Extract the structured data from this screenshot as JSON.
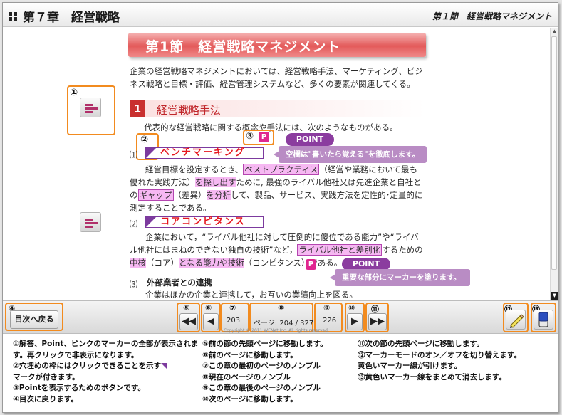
{
  "header": {
    "chapter_title": "第７章　経営戦略",
    "section_ref": "第１節　経営戦略マネジメント"
  },
  "content": {
    "section_banner": "第1節　経営戦略マネジメント",
    "intro": "企業の経営戦略マネジメントにおいては、経営戦略手法、マーケティング、ビジネス戦略と目標・評価、経営管理システムなど、多くの要素が関連してくる。",
    "topic_number": "1",
    "topic_title": "経営戦略手法",
    "topic_lead": "代表的な経営戦略に関する概念や手法には、次のようなものがある。",
    "items": [
      {
        "num": "⑴",
        "term": "ベンチマーキング",
        "body_parts": [
          "経営目標を設定するとき、",
          "ベストプラクティス",
          "（経営や業務において最も優れた実践方法）",
          "を探し出す",
          "ために, 最強のライバル他社又は先進企業と自社との",
          "ギャップ",
          "（差異）",
          "を分析",
          "して、製品、サービス、実践方法を定性的･定量的に測定することである。"
        ]
      },
      {
        "num": "⑵",
        "term": "コアコンピタンス",
        "body_parts": [
          "企業において，“ライバル他社に対して圧倒的に優位である能力”や“ライバル他社にはまねのできない独自の技術”など，",
          "ライバル他社と差別化",
          "するための",
          "中核",
          "（コア）",
          "となる能力や技術",
          "（コンピタンス）である。"
        ]
      },
      {
        "num": "⑶",
        "title": "外部業者との連携",
        "body": "企業はほかの企業と連携して，お互いの業績向上を図る。"
      }
    ],
    "p_button": "P",
    "point_label": "POINT",
    "point_note_1": "空欄は\"書いたら覚える\"を徹底します。",
    "point_note_2": "重要な部分にマーカーを塗ります。"
  },
  "callouts": [
    "①",
    "②",
    "③",
    "④",
    "⑤",
    "⑥",
    "⑦",
    "⑧",
    "⑨",
    "⑩",
    "⑪",
    "⑫",
    "⑬"
  ],
  "toolbar": {
    "back_label": "目次へ戻る",
    "first_page_of_chapter": "203",
    "page_indicator": "ページ: 204 / 327",
    "last_page_of_chapter": "226",
    "copyright": "Copyright © 2011 WENet Inc. All rights reserved."
  },
  "legend": {
    "col1": [
      "①解答、Point、ピンクのマーカーの全部が表示されます。再クリックで非表示になります。",
      "②穴埋めの枠にはクリックできることを示す",
      "マークが付きます。",
      "③Pointを表示するためのボタンです。",
      "④目次に戻ります。"
    ],
    "col2": [
      "⑤前の節の先頭ページに移動します。",
      "⑥前のページに移動します。",
      "⑦この章の最初のページのノンブル",
      "⑧現在のページのノンブル",
      "⑨この章の最後のページのノンブル",
      "⑩次のページに移動します。"
    ],
    "col3": [
      "⑪次の節の先頭ページに移動します。",
      "⑫マーカーモードのオン／オフを切り替えます。",
      "黄色いマーカー線が引けます。",
      "⑬黄色いマーカー線をまとめて消去します。"
    ]
  },
  "colors": {
    "accent_orange": "#f28b1f",
    "marker_pink": "#f6b8f2",
    "answer_red": "#e6171e",
    "purple": "#8b3c9f",
    "banner_red": "#e35a5a"
  }
}
